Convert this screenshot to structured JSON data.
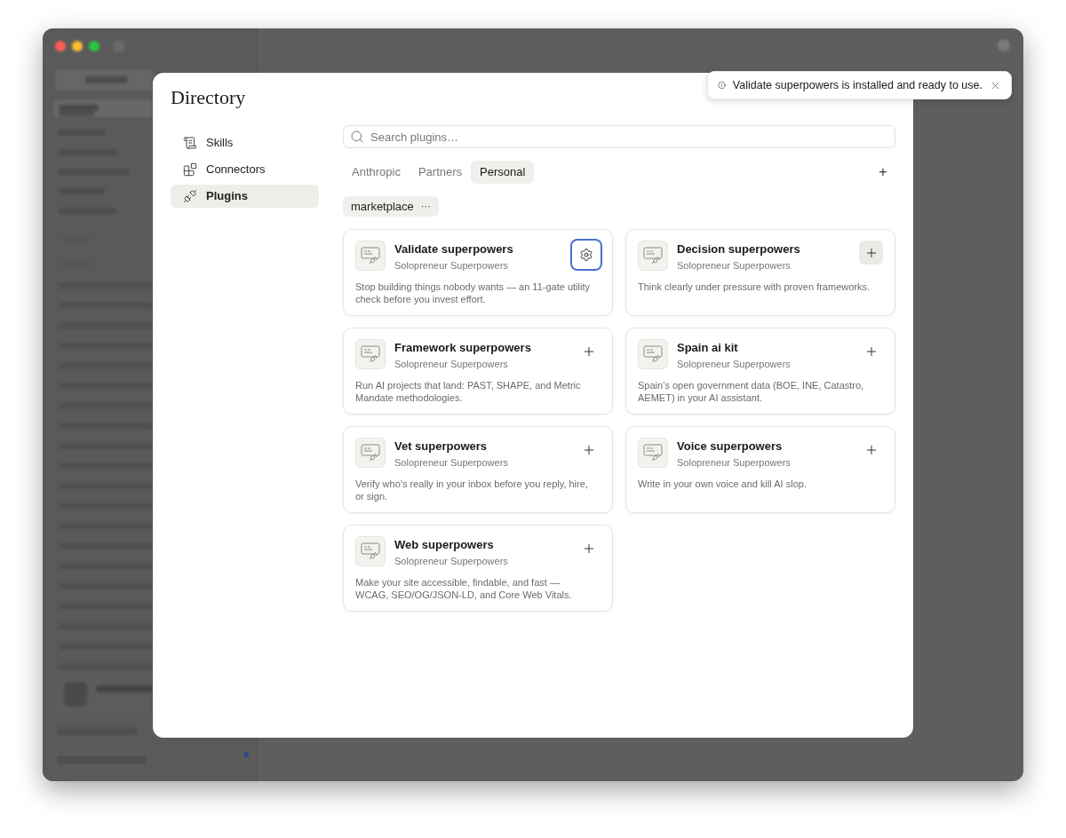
{
  "dialog": {
    "title": "Directory"
  },
  "nav": [
    {
      "label": "Skills",
      "kind": "skills",
      "selected": false
    },
    {
      "label": "Connectors",
      "kind": "connectors",
      "selected": false
    },
    {
      "label": "Plugins",
      "kind": "plugins",
      "selected": true
    }
  ],
  "search": {
    "placeholder": "Search plugins…"
  },
  "tabs": [
    {
      "label": "Anthropic",
      "selected": false
    },
    {
      "label": "Partners",
      "selected": false
    },
    {
      "label": "Personal",
      "selected": true
    }
  ],
  "add_tab_button": "+",
  "filter": {
    "label": "marketplace",
    "menu": "···"
  },
  "plugins": [
    {
      "name": "Validate superpowers",
      "publisher": "Solopreneur Superpowers",
      "description": "Stop building things nobody wants — an 11-gate utility check before you invest effort.",
      "kind": "settings",
      "focused": true,
      "hovered": false
    },
    {
      "name": "Decision superpowers",
      "publisher": "Solopreneur Superpowers",
      "description": "Think clearly under pressure with proven frameworks.",
      "kind": "add",
      "focused": false,
      "hovered": true
    },
    {
      "name": "Framework superpowers",
      "publisher": "Solopreneur Superpowers",
      "description": "Run AI projects that land: PAST, SHAPE, and Metric Mandate methodologies.",
      "kind": "add",
      "focused": false,
      "hovered": false
    },
    {
      "name": "Spain ai kit",
      "publisher": "Solopreneur Superpowers",
      "description": "Spain’s open government data (BOE, INE, Catastro, AEMET) in your AI assistant.",
      "kind": "add",
      "focused": false,
      "hovered": false
    },
    {
      "name": "Vet superpowers",
      "publisher": "Solopreneur Superpowers",
      "description": "Verify who’s really in your inbox before you reply, hire, or sign.",
      "kind": "add",
      "focused": false,
      "hovered": false
    },
    {
      "name": "Voice superpowers",
      "publisher": "Solopreneur Superpowers",
      "description": "Write in your own voice and kill AI slop.",
      "kind": "add",
      "focused": false,
      "hovered": false
    },
    {
      "name": "Web superpowers",
      "publisher": "Solopreneur Superpowers",
      "description": "Make your site accessible, findable, and fast — WCAG, SEO/OG/JSON-LD, and Core Web Vitals.",
      "kind": "add",
      "focused": false,
      "hovered": false
    }
  ],
  "toast": {
    "message": "Validate superpowers is installed and ready to use."
  }
}
